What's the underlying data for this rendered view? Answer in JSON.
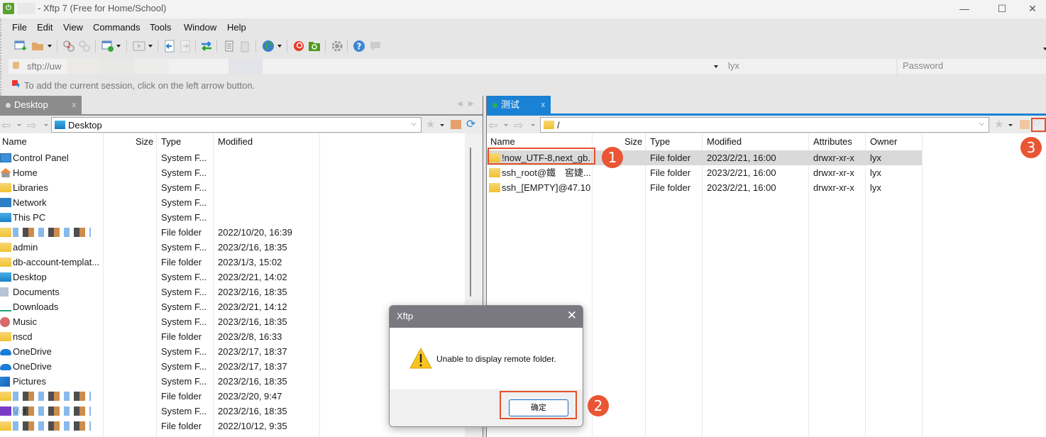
{
  "window": {
    "title": "- Xftp 7 (Free for Home/School)",
    "minimize": "—",
    "maximize": "☐",
    "close": "✕"
  },
  "menu": [
    "File",
    "Edit",
    "View",
    "Commands",
    "Tools",
    "Window",
    "Help"
  ],
  "toolbar": {
    "icons": [
      "new-session-icon",
      "open-folder-icon",
      "disconnect-icon",
      "reconnect-icon",
      "session-properties-icon",
      "play-icon",
      "upload-icon",
      "download-icon",
      "transfer-icon",
      "copy-icon",
      "paste-icon",
      "globe-icon",
      "xshell-icon",
      "xftp-icon",
      "gear-icon",
      "help-icon",
      "chat-icon"
    ]
  },
  "address": {
    "value": "sftp://uw",
    "username": "lyx",
    "password_placeholder": "Password"
  },
  "hint": "To add the current session, click on the left arrow button.",
  "left_pane": {
    "tab_label": "Desktop",
    "tab_close": "x",
    "path": "Desktop",
    "columns": [
      "Name",
      "Size",
      "Type",
      "Modified"
    ],
    "rows": [
      {
        "name": "Control Panel",
        "size": "",
        "type": "System F...",
        "modified": "",
        "icon": "control-panel-icon"
      },
      {
        "name": "Home",
        "size": "",
        "type": "System F...",
        "modified": "",
        "icon": "home-icon"
      },
      {
        "name": "Libraries",
        "size": "",
        "type": "System F...",
        "modified": "",
        "icon": "folder-icon"
      },
      {
        "name": "Network",
        "size": "",
        "type": "System F...",
        "modified": "",
        "icon": "network-icon"
      },
      {
        "name": "This PC",
        "size": "",
        "type": "System F...",
        "modified": "",
        "icon": "computer-icon"
      },
      {
        "name": "",
        "size": "",
        "type": "File folder",
        "modified": "2022/10/20, 16:39",
        "icon": "folder-icon",
        "redacted": true
      },
      {
        "name": "admin",
        "size": "",
        "type": "System F...",
        "modified": "2023/2/16, 18:35",
        "icon": "folder-icon"
      },
      {
        "name": "db-account-templat...",
        "size": "",
        "type": "File folder",
        "modified": "2023/1/3, 15:02",
        "icon": "folder-icon"
      },
      {
        "name": "Desktop",
        "size": "",
        "type": "System F...",
        "modified": "2023/2/21, 14:02",
        "icon": "desktop-icon"
      },
      {
        "name": "Documents",
        "size": "",
        "type": "System F...",
        "modified": "2023/2/16, 18:35",
        "icon": "documents-icon"
      },
      {
        "name": "Downloads",
        "size": "",
        "type": "System F...",
        "modified": "2023/2/21, 14:12",
        "icon": "download-icon"
      },
      {
        "name": "Music",
        "size": "",
        "type": "System F...",
        "modified": "2023/2/16, 18:35",
        "icon": "music-icon"
      },
      {
        "name": "nscd",
        "size": "",
        "type": "File folder",
        "modified": "2023/2/8, 16:33",
        "icon": "folder-icon"
      },
      {
        "name": "OneDrive",
        "size": "",
        "type": "System F...",
        "modified": "2023/2/17, 18:37",
        "icon": "onedrive-icon"
      },
      {
        "name": "OneDrive",
        "size": "",
        "type": "System F...",
        "modified": "2023/2/17, 18:37",
        "icon": "onedrive-icon"
      },
      {
        "name": "Pictures",
        "size": "",
        "type": "System F...",
        "modified": "2023/2/16, 18:35",
        "icon": "pictures-icon"
      },
      {
        "name": "",
        "size": "",
        "type": "File folder",
        "modified": "2023/2/20, 9:47",
        "icon": "folder-icon",
        "redacted": true
      },
      {
        "name": "Vid",
        "size": "",
        "type": "System F...",
        "modified": "2023/2/16, 18:35",
        "icon": "videos-icon",
        "redacted": true
      },
      {
        "name": "",
        "size": "",
        "type": "File folder",
        "modified": "2022/10/12, 9:35",
        "icon": "folder-icon",
        "redacted": true
      }
    ]
  },
  "right_pane": {
    "tab_label": "测试",
    "tab_close": "x",
    "path": "/",
    "columns": [
      "Name",
      "Size",
      "Type",
      "Modified",
      "Attributes",
      "Owner"
    ],
    "rows": [
      {
        "name": "!now_UTF-8,next_gb...",
        "size": "",
        "type": "File folder",
        "modified": "2023/2/21, 16:00",
        "attributes": "drwxr-xr-x",
        "owner": "lyx",
        "selected": true
      },
      {
        "name": "ssh_root@鐵　窖婕...",
        "size": "",
        "type": "File folder",
        "modified": "2023/2/21, 16:00",
        "attributes": "drwxr-xr-x",
        "owner": "lyx"
      },
      {
        "name": "ssh_[EMPTY]@47.10...",
        "size": "",
        "type": "File folder",
        "modified": "2023/2/21, 16:00",
        "attributes": "drwxr-xr-x",
        "owner": "lyx"
      }
    ]
  },
  "dialog": {
    "title": "Xftp",
    "message": "Unable to display remote folder.",
    "ok_label": "确定"
  },
  "annotations": [
    "1",
    "2",
    "3"
  ],
  "colors": {
    "accent_blue": "#1a82d4",
    "annotation_red": "#e4502d",
    "connected_green": "#22b24c"
  }
}
